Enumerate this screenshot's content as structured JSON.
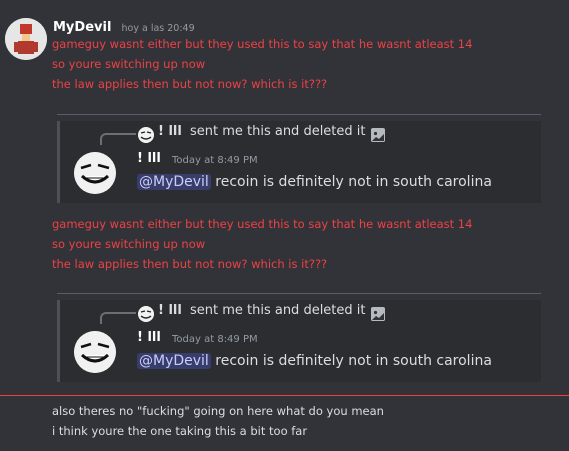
{
  "message": {
    "author": "MyDevil",
    "timestamp": "hoy a las 20:49",
    "lines": [
      "gameguy wasnt either but they used this to say that he wasnt atleast 14",
      "so youre switching up now",
      "the law applies then but not now? which is it???"
    ]
  },
  "embed": {
    "reply_author": "! lll",
    "reply_text": "sent me this and deleted it",
    "inner_author": "! lll",
    "inner_time": "Today at 8:49 PM",
    "mention": "@MyDevil",
    "inner_text": " recoin is definitely not in south carolina"
  },
  "followup": {
    "lines": [
      "gameguy wasnt either but they used this to say that he wasnt atleast 14",
      "so youre switching up now",
      "the law applies then but not now? which is it???"
    ]
  },
  "last_message": {
    "lines": [
      "also theres no \"fucking\" going on here what do you mean",
      "i think youre the one taking this a bit too far"
    ]
  },
  "colors": {
    "background": "#313338",
    "red_text": "#ed4245",
    "embed_bg": "#2b2d31",
    "new_divider": "#f23f43"
  },
  "icons": [
    "avatar-mydevil",
    "reply-avatar",
    "image-icon",
    "inner-avatar"
  ]
}
